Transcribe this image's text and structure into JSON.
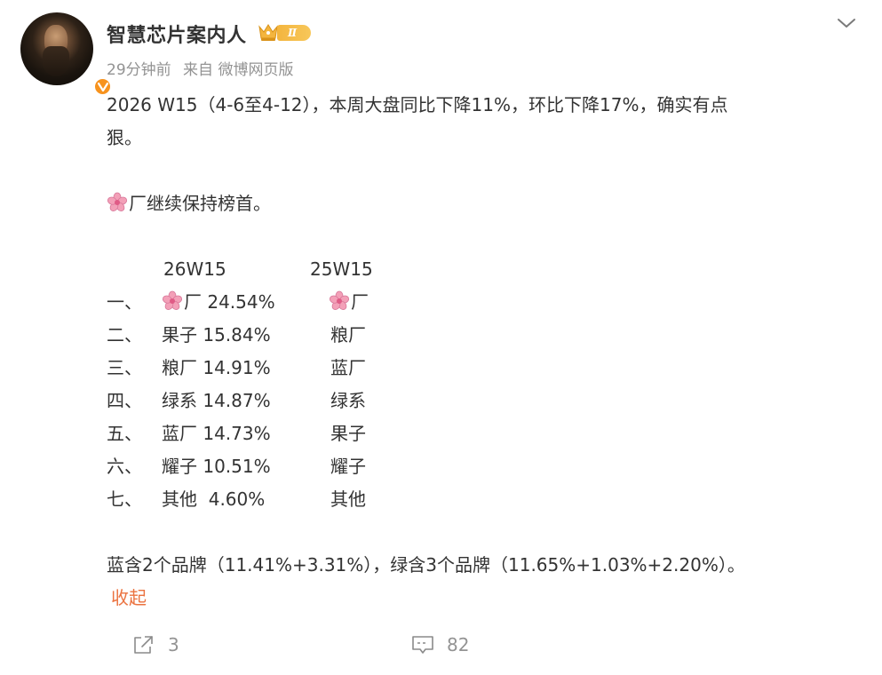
{
  "author": {
    "name": "智慧芯片案内人",
    "level_badge": "Ⅱ",
    "avatar_icon": "avatar-portrait",
    "verified_icon": "verified-v-icon"
  },
  "meta": {
    "time": "29分钟前",
    "source": "来自 微博网页版"
  },
  "post": {
    "intro_line1": "2026 W15（4-6至4-12），本周大盘同比下降11%，环比下降17%，确实有点",
    "intro_line2": "狠。",
    "lead_text": "厂继续保持榜首。",
    "table": {
      "headers": [
        "26W15",
        "25W15"
      ],
      "rows": [
        {
          "rank": "一、",
          "current": "厂 24.54%",
          "previous": "厂",
          "current_flower": true,
          "previous_flower": true
        },
        {
          "rank": "二、",
          "current": "果子 15.84%",
          "previous": "粮厂"
        },
        {
          "rank": "三、",
          "current": "粮厂 14.91%",
          "previous": "蓝厂"
        },
        {
          "rank": "四、",
          "current": "绿系 14.87%",
          "previous": "绿系"
        },
        {
          "rank": "五、",
          "current": "蓝厂 14.73%",
          "previous": "果子"
        },
        {
          "rank": "六、",
          "current": "耀子 10.51%",
          "previous": "耀子"
        },
        {
          "rank": "七、",
          "current": "其他  4.60%",
          "previous": "其他"
        }
      ]
    },
    "footnote": "蓝含2个品牌（11.41%+3.31%），绿含3个品牌（11.65%+1.03%+2.20%）。",
    "collapse_label": "收起"
  },
  "actions": {
    "repost_count": "3",
    "comment_count": "82"
  },
  "colors": {
    "text": "#333333",
    "meta": "#939393",
    "accent": "#eb7340",
    "badge": "#f7931e",
    "flower": "#f3a0b8"
  }
}
